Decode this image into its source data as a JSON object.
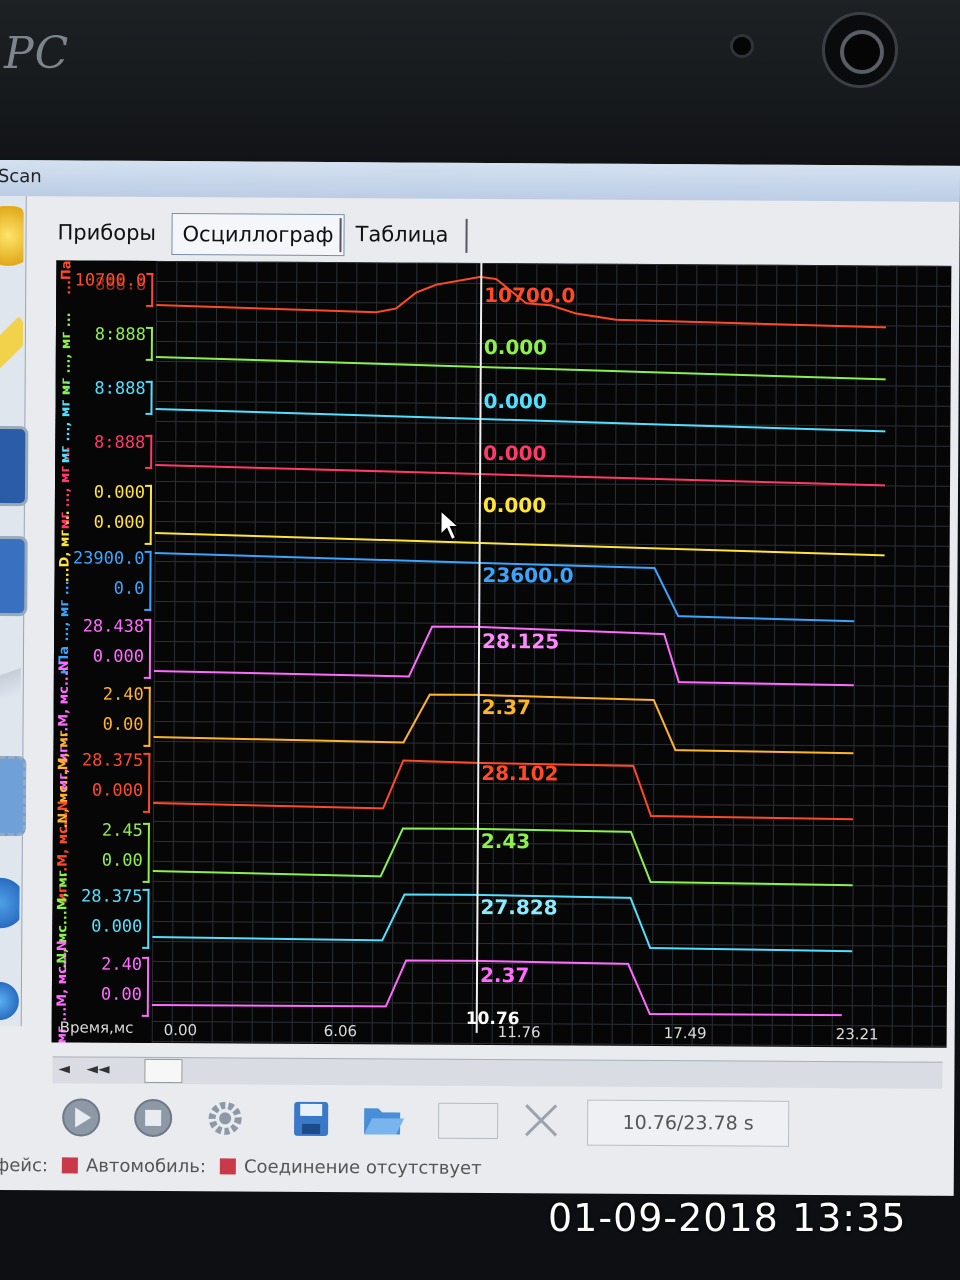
{
  "window": {
    "app_title": "Scan"
  },
  "brand": "PC",
  "tabs": [
    {
      "label": "Приборы",
      "active": false
    },
    {
      "label": "Осциллограф",
      "active": true
    },
    {
      "label": "Таблица",
      "active": false
    }
  ],
  "axis_labels": [
    "...Па",
    "мг ..., мг ...",
    "мг ..., мг ...",
    "мг ..., мг ...",
    "...D, мг ...",
    "кПа ..., мг ...",
    "мг, мг ...M, мс...N",
    "...N, мс...M, мг",
    "мг ...M, мс...N",
    "...N, мс...M, мг",
    "мг ...M, мс...N"
  ],
  "scales": [
    {
      "top": "10700.0",
      "bottom": "888.8",
      "color": "#ff4a2a"
    },
    {
      "top": "8:888",
      "bottom": "",
      "color": "#8df04e"
    },
    {
      "top": "8:888",
      "bottom": "",
      "color": "#53e0ff"
    },
    {
      "top": "8:888",
      "bottom": "",
      "color": "#ff3a6a"
    },
    {
      "top": "0.000",
      "bottom": "0.000",
      "color": "#ffe43a"
    },
    {
      "top": "23900.0",
      "bottom": "0.0",
      "color": "#3aa4ff"
    },
    {
      "top": "28.438",
      "bottom": "0.000",
      "color": "#ff6aff"
    },
    {
      "top": "2.40",
      "bottom": "0.00",
      "color": "#ffb52a"
    },
    {
      "top": "28.375",
      "bottom": "0.000",
      "color": "#ff4a2a"
    },
    {
      "top": "2.45",
      "bottom": "0.00",
      "color": "#8df04e"
    },
    {
      "top": "28.375",
      "bottom": "0.000",
      "color": "#53e0ff"
    },
    {
      "top": "2.40",
      "bottom": "0.00",
      "color": "#ff6aff"
    }
  ],
  "cursor_values": [
    {
      "value": "10700.0",
      "color": "#ff4a2a"
    },
    {
      "value": "0.000",
      "color": "#8df04e"
    },
    {
      "value": "0.000",
      "color": "#53e0ff"
    },
    {
      "value": "0.000",
      "color": "#ff3a6a"
    },
    {
      "value": "0.000",
      "color": "#ffe43a"
    },
    {
      "value": "23600.0",
      "color": "#3aa4ff"
    },
    {
      "value": "28.125",
      "color": "#ff8aff"
    },
    {
      "value": "2.37",
      "color": "#ffb52a"
    },
    {
      "value": "28.102",
      "color": "#ff4a2a"
    },
    {
      "value": "2.43",
      "color": "#8df04e"
    },
    {
      "value": "27.828",
      "color": "#8cecff"
    },
    {
      "value": "2.37",
      "color": "#ff6aff"
    }
  ],
  "cursor_time": "10.76",
  "time_axis": {
    "label": "Время,мс",
    "ticks": [
      "0.00",
      "6.06",
      "11.76",
      "17.49",
      "23.21"
    ]
  },
  "toolbar": {
    "play_icon": "play-icon",
    "stop_icon": "stop-icon",
    "settings_icon": "gear-icon",
    "save_icon": "save-icon",
    "open_icon": "folder-open-icon",
    "time_readout": "10.76/23.78 s"
  },
  "statusbar": {
    "prefix": "фейс:",
    "car_label": "Автомобиль:",
    "connection_label": "Соединение отсутствует",
    "status_color": "#c9394a"
  },
  "photo_timestamp": "01-09-2018 13:35"
}
